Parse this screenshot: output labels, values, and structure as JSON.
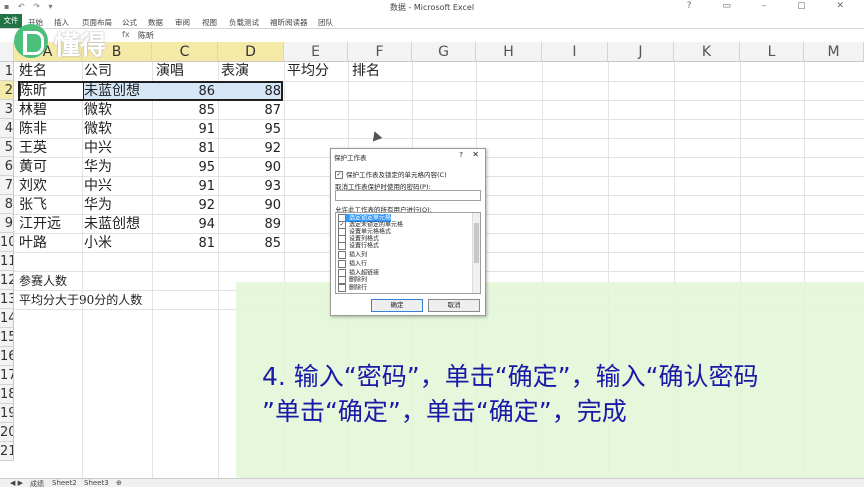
{
  "window": {
    "title": "数据 - Microsoft Excel",
    "qat": "▪ ↶ ↷ ▾",
    "controls": "? ▭ – ▢ ✕"
  },
  "ribbon": {
    "file": "文件",
    "tabs": [
      "开始",
      "插入",
      "页面布局",
      "公式",
      "数据",
      "审阅",
      "视图",
      "负载测试",
      "福昕阅读器",
      "团队"
    ]
  },
  "brand": "懂得",
  "formula_bar": {
    "fx": "fx",
    "value": "陈昕"
  },
  "columns": [
    "A",
    "B",
    "C",
    "D",
    "E",
    "F",
    "G",
    "H",
    "I",
    "J",
    "K",
    "L",
    "M"
  ],
  "row_numbers": [
    "1",
    "2",
    "3",
    "4",
    "5",
    "6",
    "7",
    "8",
    "9",
    "10",
    "11",
    "12",
    "13",
    "14",
    "15",
    "16",
    "17",
    "18",
    "19",
    "20",
    "21"
  ],
  "sheet": {
    "header": [
      "姓名",
      "公司",
      "演唱",
      "表演",
      "平均分",
      "排名"
    ],
    "rows": [
      [
        "陈昕",
        "未蓝创想",
        "86",
        "88"
      ],
      [
        "林碧",
        "微软",
        "85",
        "87"
      ],
      [
        "陈非",
        "微软",
        "91",
        "95"
      ],
      [
        "王英",
        "中兴",
        "81",
        "92"
      ],
      [
        "黄可",
        "华为",
        "95",
        "90"
      ],
      [
        "刘欢",
        "中兴",
        "91",
        "93"
      ],
      [
        "张飞",
        "华为",
        "92",
        "90"
      ],
      [
        "江开远",
        "未蓝创想",
        "94",
        "89"
      ],
      [
        "叶路",
        "小米",
        "81",
        "85"
      ]
    ],
    "note1": "参赛人数",
    "note2": "平均分大于90分的人数"
  },
  "dialog": {
    "title": "保护工作表",
    "help": "?",
    "close": "✕",
    "protect_option": "保护工作表及锁定的单元格内容(C)",
    "password_label": "取消工作表保护时使用的密码(P):",
    "allow_label": "允许此工作表的所有用户进行(O):",
    "permissions": [
      "选定锁定单元格",
      "选定未锁定的单元格",
      "设置单元格格式",
      "设置列格式",
      "设置行格式",
      "插入列",
      "插入行",
      "插入超链接",
      "删除列",
      "删除行"
    ],
    "checked": [
      true,
      true,
      false,
      false,
      false,
      false,
      false,
      false,
      false,
      false
    ],
    "ok": "确定",
    "cancel": "取消"
  },
  "caption": {
    "line1": "4. 输入“密码”，单击“确定”，输入“确认密码",
    "line2": "”单击“确定”，单击“确定”，完成"
  },
  "sheet_tabs": [
    "成绩",
    "Sheet2",
    "Sheet3"
  ]
}
